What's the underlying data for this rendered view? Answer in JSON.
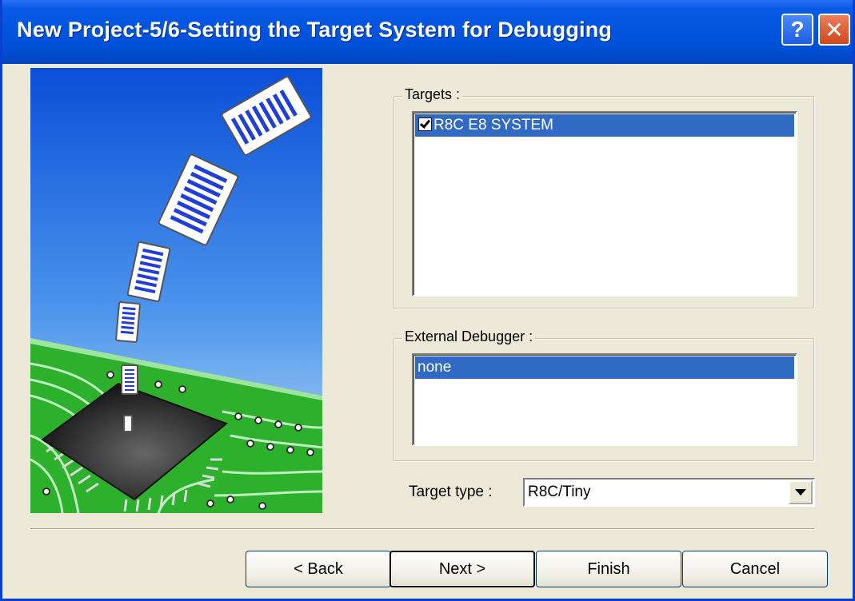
{
  "window": {
    "title": "New Project-5/6-Setting the Target System for Debugging"
  },
  "titlebar": {
    "help_icon": "?",
    "close_icon": "✕"
  },
  "targets": {
    "group_label": "Targets :",
    "items": [
      {
        "label": "R8C E8 SYSTEM",
        "checked": true,
        "selected": true
      }
    ]
  },
  "external_debugger": {
    "group_label": "External Debugger :",
    "items": [
      {
        "label": "none",
        "selected": true
      }
    ]
  },
  "target_type": {
    "label": "Target type :",
    "value": "R8C/Tiny"
  },
  "buttons": {
    "back": "< Back",
    "next": "Next >",
    "finish": "Finish",
    "cancel": "Cancel"
  },
  "colors": {
    "title_bar": "#0250d6",
    "selection": "#316ac5",
    "dialog_bg": "#ece9d8",
    "pcb_green": "#2db12d"
  }
}
